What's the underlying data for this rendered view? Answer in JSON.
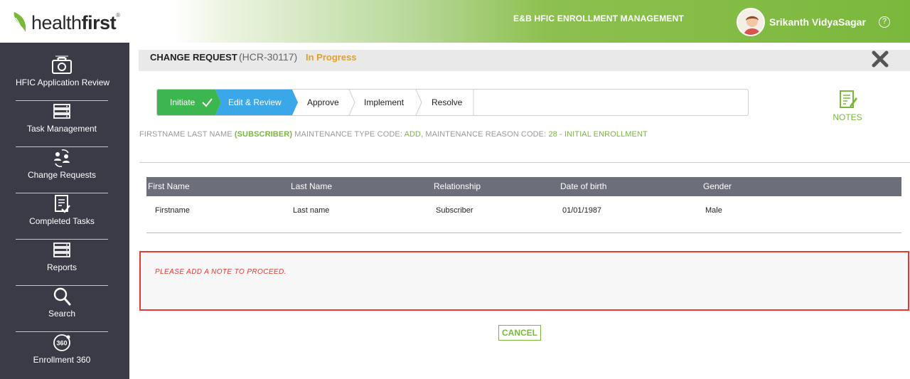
{
  "header": {
    "logo_regular": "health",
    "logo_bold": "first",
    "logo_mark": "®",
    "app_title": "E&B HFIC ENROLLMENT MANAGEMENT",
    "user_name": "Srikanth VidyaSagar",
    "help_icon": "question-circle-icon",
    "help_glyph": "?"
  },
  "sidebar": {
    "items": [
      {
        "label": "HFIC Application Review",
        "icon": "camera-icon"
      },
      {
        "label": "Task Management",
        "icon": "server-stack-icon"
      },
      {
        "label": "Change Requests",
        "icon": "people-exchange-icon"
      },
      {
        "label": "Completed Tasks",
        "icon": "checklist-icon"
      },
      {
        "label": "Reports",
        "icon": "server-stack-icon"
      },
      {
        "label": "Search",
        "icon": "magnifier-icon"
      },
      {
        "label": "Enrollment 360",
        "icon": "360-badge-icon",
        "badge": "360"
      }
    ]
  },
  "change_request": {
    "title": "CHANGE REQUEST",
    "id": "(HCR-30117)",
    "status": "In Progress"
  },
  "stepper": {
    "steps": [
      {
        "label": "Initiate",
        "state": "done"
      },
      {
        "label": "Edit & Review",
        "state": "active"
      },
      {
        "label": "Approve",
        "state": "pending"
      },
      {
        "label": "Implement",
        "state": "pending"
      },
      {
        "label": "Resolve",
        "state": "pending"
      }
    ]
  },
  "notes": {
    "label": "NOTES"
  },
  "info": {
    "name_prefix": "FIRSTNAME LAST NAME",
    "subscriber_tag": "(SUBSCRIBER)",
    "type_label": "MAINTENANCE TYPE CODE:",
    "type_value": "ADD,",
    "reason_label": "MAINTENANCE REASON CODE:",
    "reason_value": "28 - INITIAL ENROLLMENT"
  },
  "table": {
    "headers": [
      "First Name",
      "Last Name",
      "Relationship",
      "Date of birth",
      "Gender"
    ],
    "rows": [
      [
        "Firstname",
        "Last name",
        "Subscriber",
        "01/01/1987",
        "Male"
      ]
    ]
  },
  "alert": {
    "message": "PLEASE ADD A NOTE TO PROCEED."
  },
  "actions": {
    "cancel_label": "CANCEL"
  },
  "colors": {
    "brand_green": "#7ab83c",
    "step_done": "#3cb64e",
    "step_active": "#3aa7e8",
    "status_orange": "#e0a030",
    "alert_red": "#e53935",
    "sidebar_bg": "#3a3b46"
  }
}
